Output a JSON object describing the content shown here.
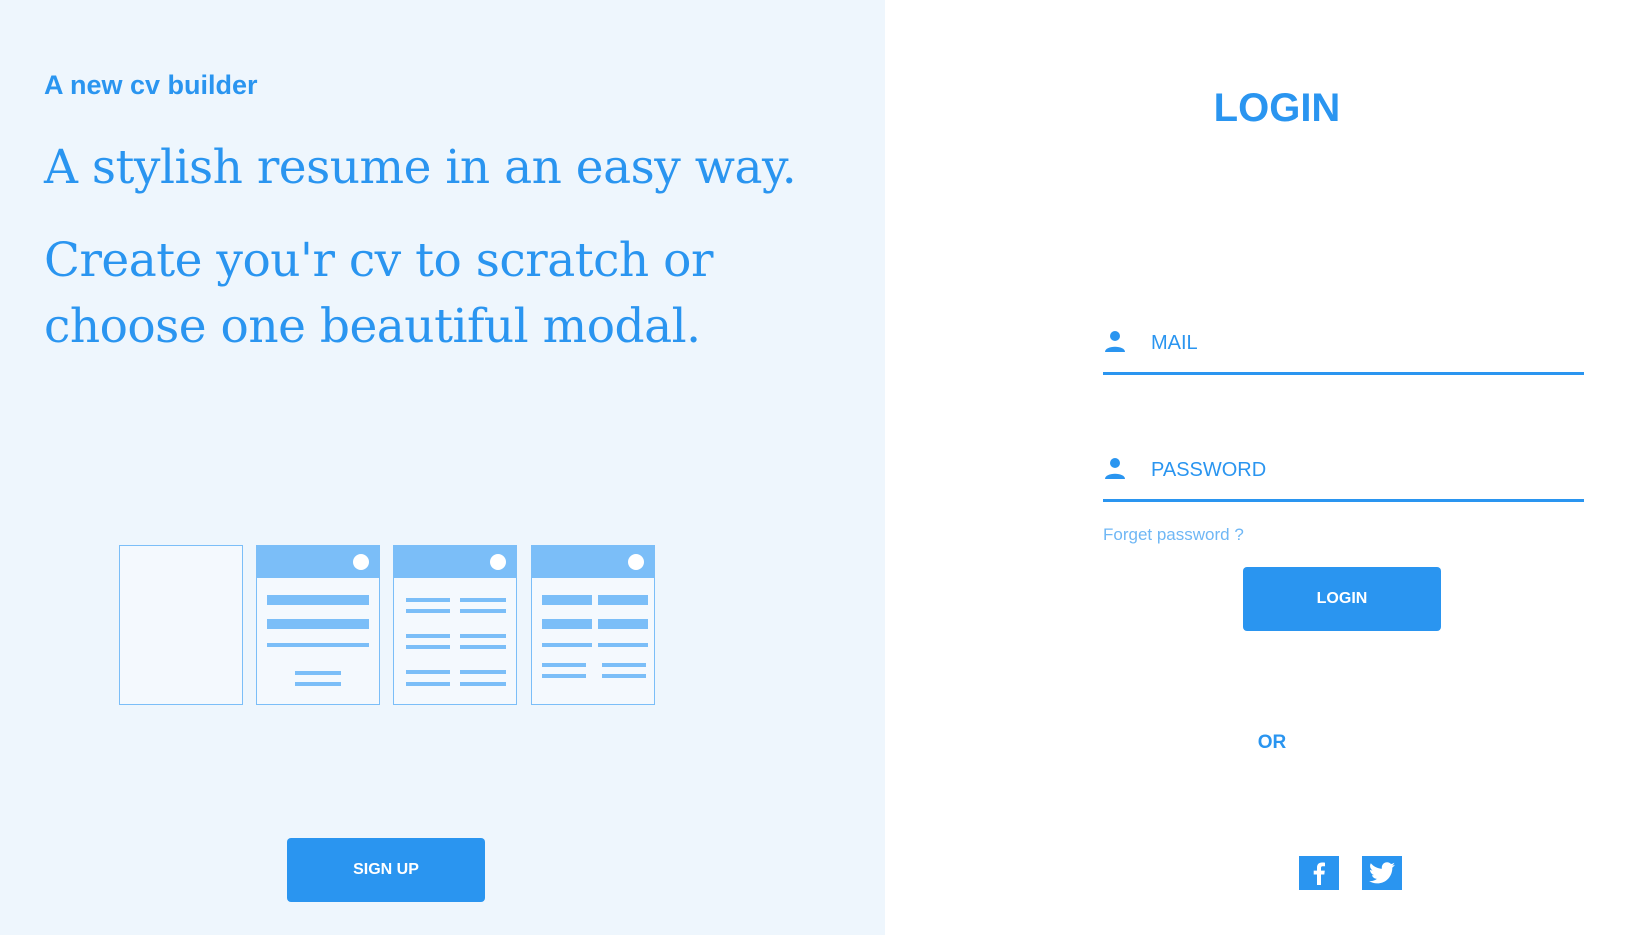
{
  "left": {
    "tagline": "A new cv builder",
    "headline": "A stylish resume in an easy way.",
    "subline": "Create you'r cv to scratch or choose one beautiful modal.",
    "signup_label": "SIGN UP",
    "templates": [
      "blank-template",
      "template-1",
      "template-2",
      "template-3"
    ]
  },
  "login": {
    "title": "LOGIN",
    "mail_placeholder": "MAIL",
    "password_placeholder": "PASSWORD",
    "forget_label": "Forget password ?",
    "login_label": "LOGIN",
    "or_label": "OR",
    "social": [
      "facebook-icon",
      "twitter-icon"
    ]
  },
  "colors": {
    "accent": "#2a95f0",
    "light_accent": "#7bbef8",
    "left_bg": "#eef6fd",
    "right_bg": "#ffffff"
  }
}
